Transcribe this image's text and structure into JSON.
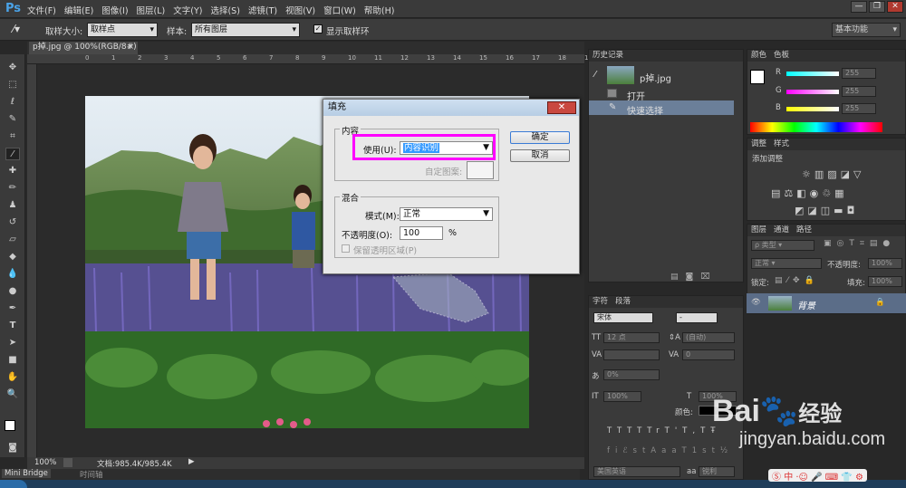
{
  "app": {
    "logo": "Ps",
    "menus": [
      "文件(F)",
      "编辑(E)",
      "图像(I)",
      "图层(L)",
      "文字(Y)",
      "选择(S)",
      "滤镜(T)",
      "视图(V)",
      "窗口(W)",
      "帮助(H)"
    ]
  },
  "window_controls": {
    "minimize": "—",
    "restore": "❐",
    "close": "✕"
  },
  "options": {
    "sample_size_label": "取样大小:",
    "sample_size_value": "取样点",
    "sample_label": "样本:",
    "sample_value": "所有图层",
    "show_ring_label": "显示取样环",
    "workspace": "基本功能"
  },
  "document": {
    "tab": "p掉.jpg @ 100%(RGB/8#)",
    "tab_close": "×",
    "zoom": "100%",
    "doc_info": "文档:985.4K/985.4K"
  },
  "ruler_ticks": [
    "0",
    "1",
    "2",
    "3",
    "4",
    "5",
    "6",
    "7",
    "8",
    "9",
    "10",
    "11",
    "12",
    "13",
    "14",
    "15",
    "16",
    "17",
    "18",
    "19"
  ],
  "bottom_tabs": [
    "Mini Bridge",
    "时间轴"
  ],
  "dialog": {
    "title": "填充",
    "content_group": "内容",
    "use_label": "使用(U):",
    "use_value": "内容识别",
    "custom_pattern_label": "自定图案:",
    "blend_group": "混合",
    "mode_label": "模式(M):",
    "mode_value": "正常",
    "opacity_label": "不透明度(O):",
    "opacity_value": "100",
    "opacity_unit": "%",
    "preserve_label": "保留透明区域(P)",
    "ok": "确定",
    "cancel": "取消",
    "close": "✕"
  },
  "history": {
    "tabs": [
      "历史记录"
    ],
    "snapshot": "p掉.jpg",
    "items": [
      "打开",
      "快速选择"
    ]
  },
  "color_panel": {
    "tabs": [
      "颜色",
      "色板"
    ],
    "channels": [
      {
        "name": "R",
        "value": "255"
      },
      {
        "name": "G",
        "value": "255"
      },
      {
        "name": "B",
        "value": "255"
      }
    ]
  },
  "adjustments": {
    "tabs": [
      "调整",
      "样式"
    ],
    "title": "添加调整"
  },
  "layers": {
    "tabs": [
      "图层",
      "通道",
      "路径"
    ],
    "filter": "类型",
    "blend": "正常",
    "opacity_label": "不透明度:",
    "opacity_value": "100%",
    "lock_label": "锁定:",
    "fill_label": "填充:",
    "fill_value": "100%",
    "layer_name": "背景"
  },
  "character": {
    "tabs": [
      "字符",
      "段落"
    ],
    "font": "宋体",
    "size": "12 点",
    "leading": "(自动)",
    "tracking": "0",
    "kerning_auto": "0%",
    "vscale": "100%",
    "hscale": "100%",
    "color_label": "颜色:",
    "language": "美国英语",
    "aa": "锐利",
    "aa_prefix": "aa",
    "text_buttons": [
      "T",
      "T",
      "TT",
      "Tr",
      "T'",
      "T,",
      "T",
      "Ŧ"
    ],
    "glyph_buttons": [
      "fi",
      "ℰ",
      "st",
      "A",
      "aa",
      "T",
      "1st",
      "½"
    ]
  },
  "watermark": {
    "brand": "Bai",
    "brand_suffix": "经验",
    "url": "jingyan.baidu.com"
  },
  "ime": {
    "label": "中"
  },
  "accent_color": "#ff00ff"
}
